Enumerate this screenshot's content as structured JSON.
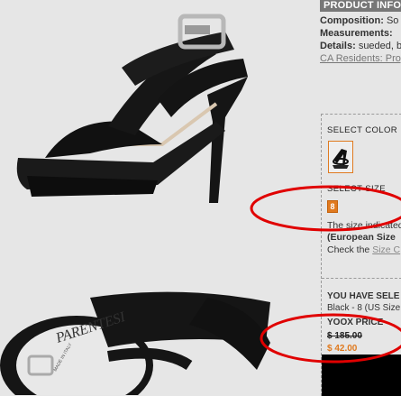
{
  "product_info": {
    "header": "PRODUCT INFO",
    "composition_label": "Composition:",
    "composition_value": "So",
    "measurements_label": "Measurements:",
    "details_label": "Details:",
    "details_value": "sueded, b",
    "ca_residents_link": "CA Residents: Prop"
  },
  "select": {
    "color_label": "SELECT COLOR",
    "size_label": "SELECT SIZE",
    "size_value": "8",
    "size_note_1": "The size indicated",
    "size_note_2": "(European Size",
    "size_note_3_prefix": "Check the",
    "size_chart_link": "Size C",
    "you_have_selected": "YOU HAVE SELE",
    "selection_value": "Black - 8 (US Size",
    "yoox_price_label": "YOOX PRICE",
    "price_old": "$ 185.00",
    "price_new": "$ 42.00"
  },
  "shoe_image": {
    "brand_label": "PARENTESI",
    "made_in": "MADE IN ITALY"
  },
  "colors": {
    "accent": "#e07a1f",
    "annotation": "#e00000",
    "header_bg": "#777777"
  }
}
